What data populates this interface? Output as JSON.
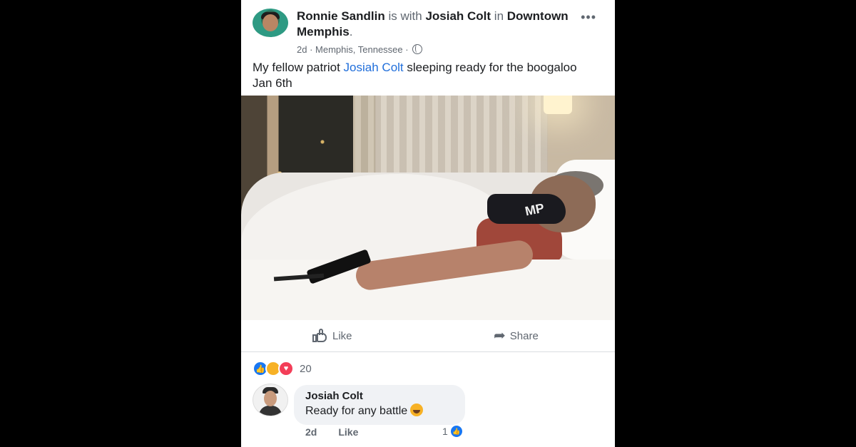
{
  "post": {
    "author": "Ronnie Sandlin",
    "with_text": "is with",
    "tagged": "Josiah Colt",
    "in_text": "in",
    "location": "Downtown Memphis",
    "time": "2d",
    "place": "Memphis, Tennessee",
    "more": "•••",
    "text_before": "My fellow patriot ",
    "text_link": "Josiah Colt",
    "text_after": " sleeping ready for the boogaloo Jan 6th",
    "mask_text": "MP"
  },
  "actions": {
    "like_label": "Like",
    "share_label": "Share"
  },
  "reactions": {
    "count": "20"
  },
  "comment": {
    "author": "Josiah Colt",
    "text": "Ready for any battle",
    "time": "2d",
    "like_label": "Like",
    "likes": "1"
  },
  "colors": {
    "link": "#216fdb",
    "like_blue": "#1877f2",
    "haha_yellow": "#f7b125",
    "love_red": "#f33e58"
  },
  "icons": [
    "more-icon",
    "globe-icon",
    "like-icon",
    "share-icon",
    "laugh-emoji-icon"
  ]
}
